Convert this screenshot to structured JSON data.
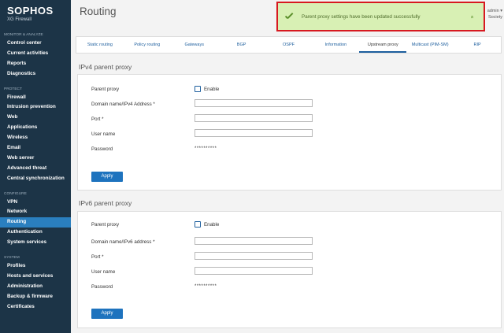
{
  "brand": {
    "logo": "SOPHOS",
    "product": "XG Firewall"
  },
  "sidebar": {
    "sections": [
      {
        "title": "MONITOR & ANALYZE",
        "items": [
          "Control center",
          "Current activities",
          "Reports",
          "Diagnostics"
        ]
      },
      {
        "title": "PROTECT",
        "items": [
          "Firewall",
          "Intrusion prevention",
          "Web",
          "Applications",
          "Wireless",
          "Email",
          "Web server",
          "Advanced threat",
          "Central synchronization"
        ]
      },
      {
        "title": "CONFIGURE",
        "items": [
          "VPN",
          "Network",
          "Routing",
          "Authentication",
          "System services"
        ]
      },
      {
        "title": "SYSTEM",
        "items": [
          "Profiles",
          "Hosts and services",
          "Administration",
          "Backup & firmware",
          "Certificates"
        ]
      }
    ],
    "active": "Routing"
  },
  "header": {
    "title": "Routing",
    "user_line1": "admin ▾",
    "user_line2": "Society"
  },
  "notification": {
    "message": "Parent proxy settings have been updated successfully",
    "collapse_glyph": "»"
  },
  "tabs": [
    {
      "label": "Static routing",
      "active": false
    },
    {
      "label": "Policy routing",
      "active": false
    },
    {
      "label": "Gateways",
      "active": false
    },
    {
      "label": "BGP",
      "active": false
    },
    {
      "label": "OSPF",
      "active": false
    },
    {
      "label": "Information",
      "active": false
    },
    {
      "label": "Upstream proxy",
      "active": true
    },
    {
      "label": "Multicast (PIM-SM)",
      "active": false
    },
    {
      "label": "RIP",
      "active": false
    }
  ],
  "ipv4": {
    "heading": "IPv4 parent proxy",
    "parent_proxy_label": "Parent proxy",
    "enable_label": "Enable",
    "domain_label": "Domain name/IPv4 Address *",
    "domain_value": "",
    "port_label": "Port *",
    "port_value": "",
    "username_label": "User name",
    "username_value": "",
    "password_label": "Password",
    "password_value": "**********",
    "apply_label": "Apply"
  },
  "ipv6": {
    "heading": "IPv6 parent proxy",
    "parent_proxy_label": "Parent proxy",
    "enable_label": "Enable",
    "domain_label": "Domain name/IPv6 address *",
    "domain_value": "",
    "port_label": "Port *",
    "port_value": "",
    "username_label": "User name",
    "username_value": "",
    "password_label": "Password",
    "password_value": "**********",
    "apply_label": "Apply"
  },
  "colors": {
    "sidebar_bg": "#1c3447",
    "active_nav": "#2a7fbf",
    "link_blue": "#1e5f9e",
    "notify_bg": "#d8f0b4",
    "notify_border": "#d71920",
    "button_blue": "#1e73be"
  }
}
